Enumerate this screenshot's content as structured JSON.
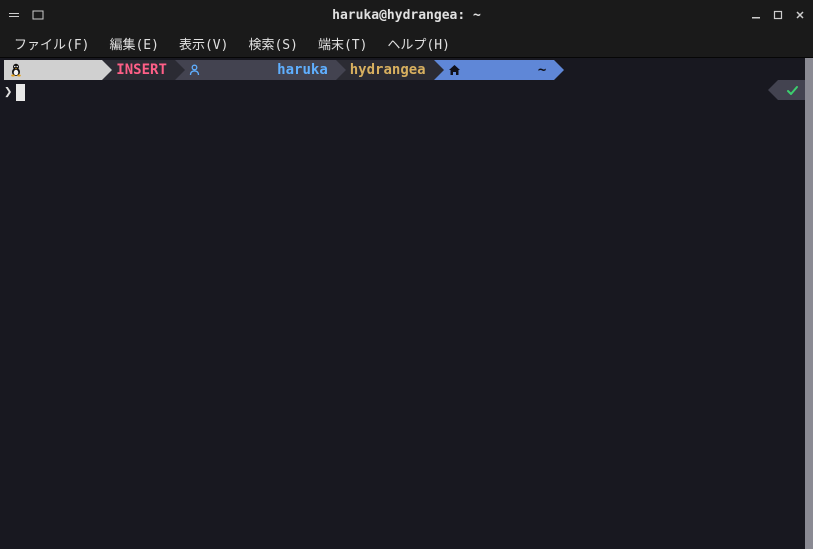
{
  "window": {
    "title": "haruka@hydrangea: ~"
  },
  "menubar": {
    "items": [
      "ファイル(F)",
      "編集(E)",
      "表示(V)",
      "検索(S)",
      "端末(T)",
      "ヘルプ(H)"
    ]
  },
  "prompt": {
    "os_icon": "tux-icon",
    "mode": "INSERT",
    "user_icon": "user-icon",
    "user": "haruka",
    "host": "hydrangea",
    "path_icon": "home-icon",
    "path": "~",
    "caret": "❯",
    "input_value": ""
  },
  "status": {
    "ok_icon": "check-icon"
  }
}
